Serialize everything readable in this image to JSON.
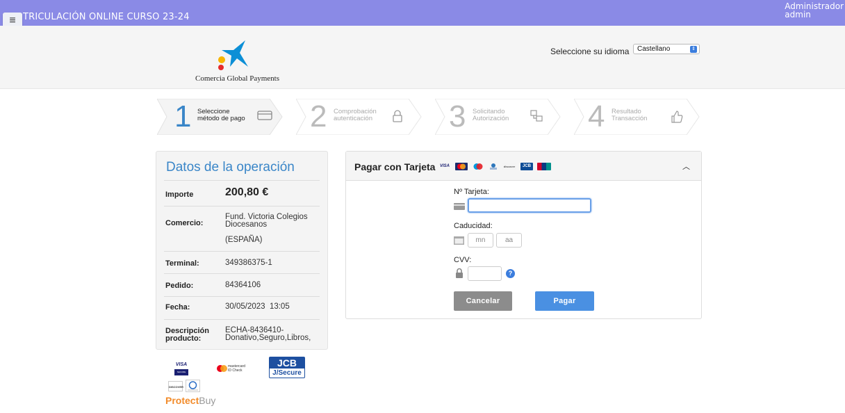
{
  "topbar": {
    "menu_icon": "hamburger-icon",
    "title": "TRICULACIÓN ONLINE CURSO 23-24",
    "user_name": "Administrador",
    "user_login": "admin"
  },
  "header": {
    "logo_text": "Comercia Global Payments",
    "language_label": "Seleccione su idioma",
    "language_value": "Castellano"
  },
  "steps": [
    {
      "number": "1",
      "line1": "Seleccione",
      "line2": "método de pago",
      "icon": "credit-card-icon",
      "active": true
    },
    {
      "number": "2",
      "line1": "Comprobación",
      "line2": "autenticación",
      "icon": "lock-icon",
      "active": false
    },
    {
      "number": "3",
      "line1": "Solicitando",
      "line2": "Autorización",
      "icon": "transfer-icon",
      "active": false
    },
    {
      "number": "4",
      "line1": "Resultado",
      "line2": "Transacción",
      "icon": "thumbs-up-icon",
      "active": false
    }
  ],
  "operation": {
    "title": "Datos de la operación",
    "rows": {
      "importe": {
        "label": "Importe",
        "value": "200,80 €"
      },
      "comercio": {
        "label": "Comercio:",
        "value_line1": "Fund. Victoria Colegios",
        "value_line2": "Diocesanos",
        "value_line3": "(ESPAÑA)"
      },
      "terminal": {
        "label": "Terminal:",
        "value": "349386375-1"
      },
      "pedido": {
        "label": "Pedido:",
        "value": "84364106"
      },
      "fecha": {
        "label": "Fecha:",
        "value": "30/05/2023  13:05"
      },
      "descripcion": {
        "label_line1": "Descripción",
        "label_line2": "producto:",
        "value_line1": "ECHA-8436410-",
        "value_line2": "Donativo,Seguro,Libros,"
      }
    }
  },
  "card_payment": {
    "title": "Pagar con Tarjeta",
    "brands": [
      "VISA",
      "mastercard",
      "maestro",
      "amex",
      "discover",
      "JCB",
      "UnionPay"
    ],
    "card_number_label": "Nº Tarjeta:",
    "card_number_value": "",
    "expiry_label": "Caducidad:",
    "month_placeholder": "mn",
    "year_placeholder": "aa",
    "cvv_label": "CVV:",
    "cvv_value": "",
    "cancel_label": "Cancelar",
    "pay_label": "Pagar"
  },
  "secure_logos": {
    "visa_top": "VISA",
    "visa_bottom": "SECURE",
    "mastercard_line1": "mastercard",
    "mastercard_line2": "ID Check",
    "jcb_top": "JCB",
    "jcb_bottom": "J/Secure",
    "discover": "DISCOVER",
    "protect_a": "Protect",
    "protect_b": "Buy"
  },
  "colors": {
    "topbar": "#8a8ae6",
    "accent_blue": "#3a86c8",
    "pay_button": "#4a90e2",
    "cancel_button": "#8c8c8c"
  }
}
